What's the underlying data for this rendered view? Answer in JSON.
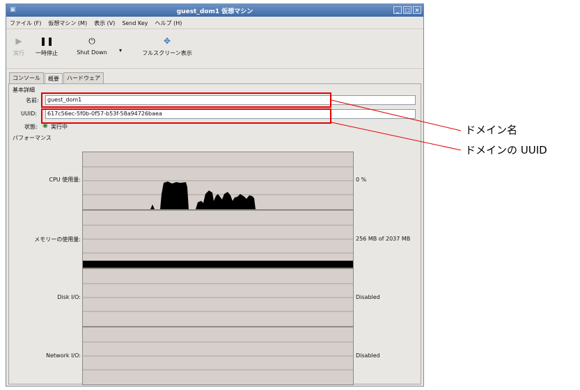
{
  "window": {
    "title": "guest_dom1 仮想マシン"
  },
  "menu": [
    "ファイル (F)",
    "仮想マシン (M)",
    "表示 (V)",
    "Send Key",
    "ヘルプ (H)"
  ],
  "toolbar": {
    "run": "実行",
    "pause": "一時停止",
    "shutdown": "Shut Down",
    "fullscreen": "フルスクリーン表示"
  },
  "tabs": [
    "コンソール",
    "概要",
    "ハードウェア"
  ],
  "overview": {
    "section_basic": "基本詳細",
    "name_label": "名前:",
    "name_value": "guest_dom1",
    "uuid_label": "UUID:",
    "uuid_value": "617c56ec-5f0b-0f57-b53f-58a94726baea",
    "status_label": "状態:",
    "status_value": "実行中",
    "section_perf": "パフォーマンス"
  },
  "performance": {
    "cpu": {
      "label": "CPU 使用量:",
      "value": "0 %"
    },
    "memory": {
      "label": "メモリーの使用量:",
      "value": "256 MB of 2037 MB",
      "fraction": 0.126
    },
    "disk": {
      "label": "Disk I/O:",
      "value": "Disabled"
    },
    "network": {
      "label": "Network I/O:",
      "value": "Disabled"
    }
  },
  "annotations": {
    "domain_name": "ドメイン名",
    "domain_uuid": "ドメインの UUID"
  },
  "colors": {
    "highlight": "#e00000",
    "titlebar": "#4f78b3",
    "graph_bg": "#d7cfcb"
  }
}
